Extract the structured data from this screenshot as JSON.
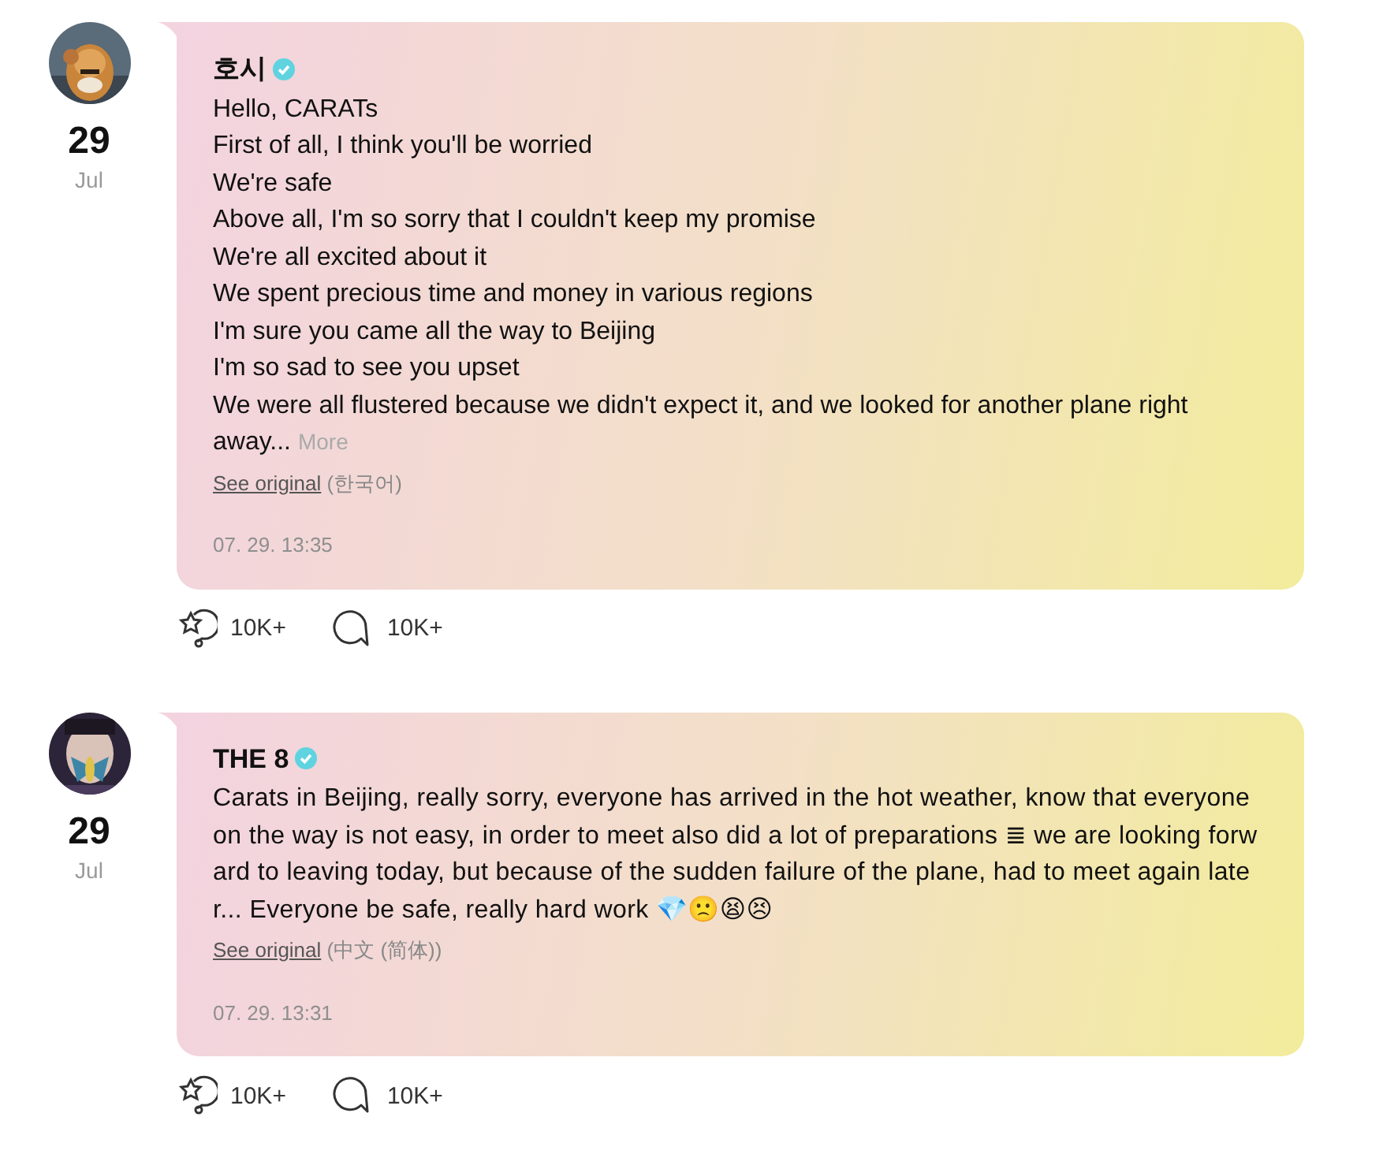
{
  "posts": [
    {
      "date_day": "29",
      "date_month": "Jul",
      "author": "호시",
      "verified": true,
      "lines": [
        "Hello, CARATs",
        "First of all, I think you'll be worried",
        "We're safe",
        "Above all, I'm so sorry that I couldn't keep my promise",
        "We're all excited about it",
        "We spent precious time and money in various regions",
        "I'm sure you came all the way to Beijing",
        "I'm so sad to see you upset",
        "We were all flustered because we didn't expect it, and we looked for another plane right",
        "away..."
      ],
      "more": "More",
      "see_original": "See original",
      "original_language": "(한국어)",
      "timestamp": "07. 29. 13:35",
      "reactions": "10K+",
      "comments": "10K+"
    },
    {
      "date_day": "29",
      "date_month": "Jul",
      "author": "THE 8",
      "verified": true,
      "text": "Carats in Beijing, really sorry, everyone has arrived in the hot weather, know that everyone on the way is not easy, in order to meet also did a lot of preparations ≣ we are looking forward to leaving today, but because of the sudden failure of the plane, had to meet again later... Everyone be safe, really hard work 💎🙁😫😣",
      "see_original": "See original",
      "original_language": "(中文 (简体))",
      "timestamp": "07. 29. 13:31",
      "reactions": "10K+",
      "comments": "10K+"
    }
  ]
}
